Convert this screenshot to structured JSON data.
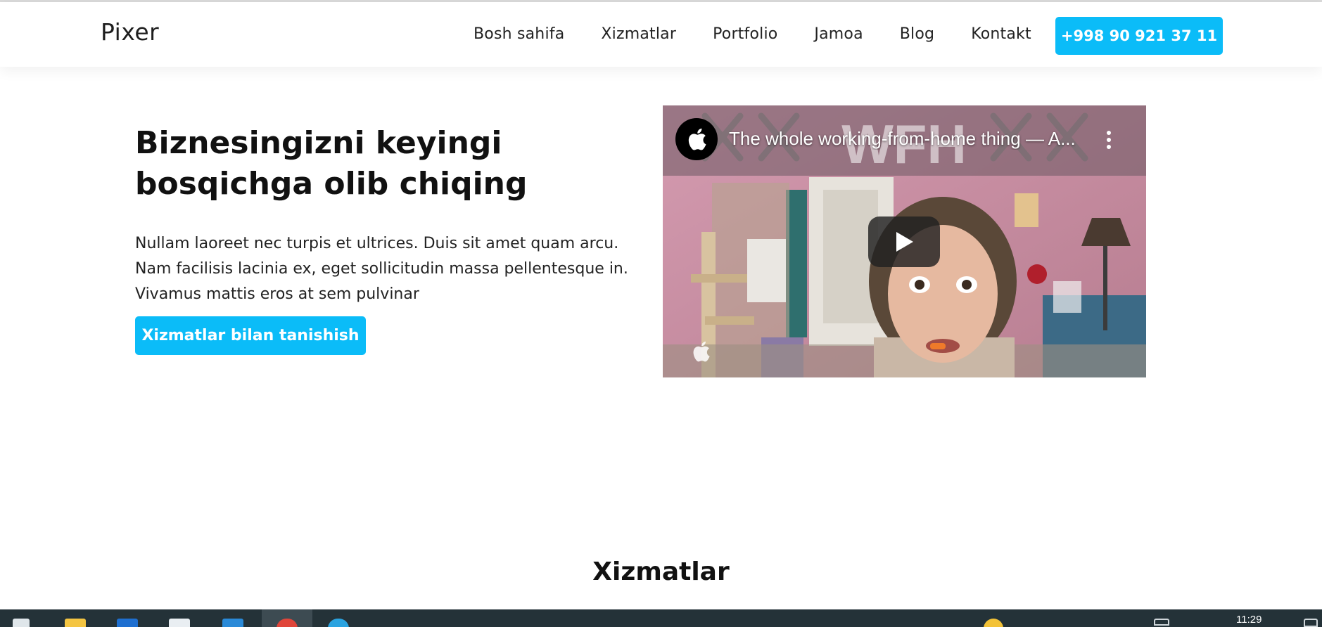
{
  "header": {
    "logo": "Pixer",
    "nav": [
      {
        "label": "Bosh sahifa"
      },
      {
        "label": "Xizmatlar"
      },
      {
        "label": "Portfolio"
      },
      {
        "label": "Jamoa"
      },
      {
        "label": "Blog"
      },
      {
        "label": "Kontakt"
      }
    ],
    "phone_button": "+998 90 921 37 11"
  },
  "hero": {
    "title": "Biznesingizni keyingi bosqichga olib chiqing",
    "text": "Nullam laoreet nec turpis et ultrices. Duis sit amet quam arcu. Nam facilisis lacinia ex, eget sollicitudin massa pellentesque in. Vivamus mattis eros at sem pulvinar",
    "cta": "Xizmatlar bilan tanishish"
  },
  "video": {
    "title": "The whole working-from-home thing — A...",
    "overlay_text": "WFH",
    "channel_icon": "apple-logo-icon"
  },
  "services": {
    "title": "Xizmatlar"
  },
  "taskbar": {
    "time": "11:29"
  },
  "colors": {
    "accent": "#0bbcf8",
    "taskbar": "#243238"
  }
}
